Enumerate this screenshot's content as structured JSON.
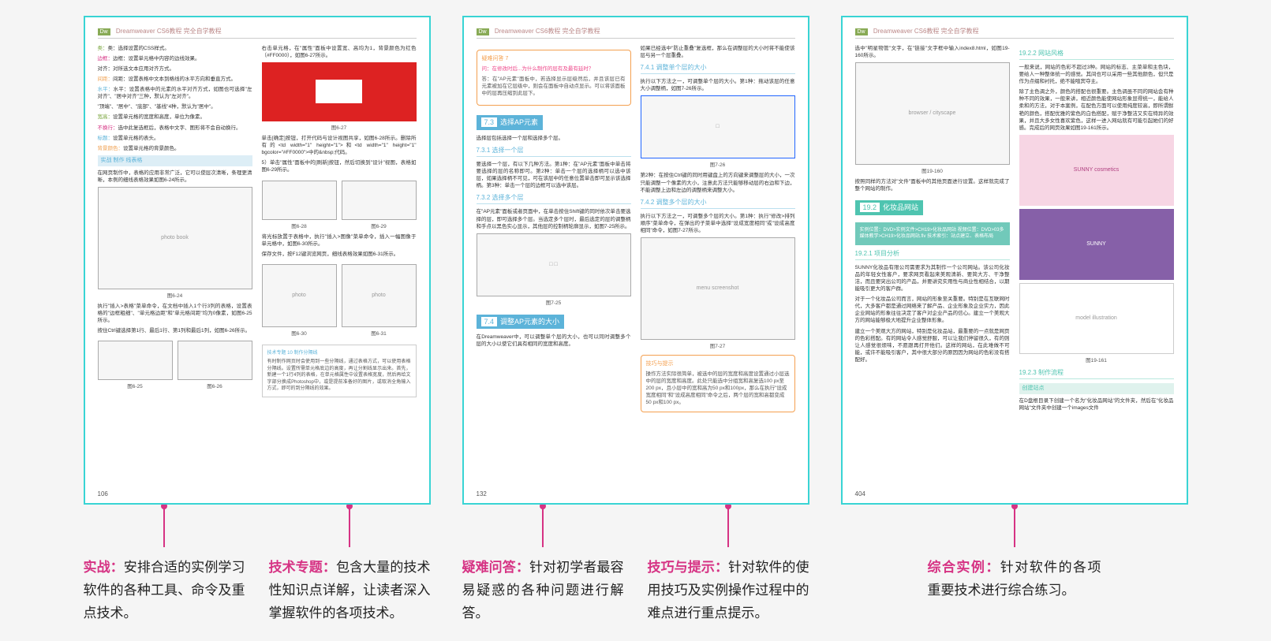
{
  "pages": {
    "p1": {
      "header_brand": "Dreamweaver CS6教程",
      "header_suffix": "完全自学教程",
      "left": {
        "l1": "类：选择设置的CSS样式。",
        "l2": "边框：设置单元格中内容的边线效果。",
        "l3": "对齐：对所选文本应用对齐方式。",
        "l4": "间距：设置表格中文本到格线的水平方向和垂直方式。",
        "l5": "水平：设置表格中的元素的水平对齐方式，如图也可选择\"左对齐\"、\"居中对齐\"三种，默认为\"左对齐\"。",
        "l6": "\"顶端\"、\"居中\"、\"底部\"、\"基线\"4种，默认为\"居中\"。",
        "l7_k": "宽高：",
        "l7": "设置单元格的宽度和高度，单位为像素。",
        "l8_k": "不换行：",
        "l8": "选中此复选框后，表格中文字、图形将不会自动换行。",
        "l9_k": "标题：",
        "l9": "设置单元格的表头。",
        "l10_k": "背景颜色：",
        "l10": "设置单元格的背景颜色。",
        "practice": "实战  制作    线表格",
        "p11": "在网页制作中，表格的应用非常广泛，它可以使层次清晰，条理更清晰，本例的细线表格效果如图6-24所示。",
        "p12": "执行\"插入>表格\"菜单命令，在文档中插入1个行3列的表格，设置表格的\"边框粗细\"、\"单元格边距\"和\"单元格间距\"均为0像素，如图6-25所示。",
        "p13": "按住Ctrl键选择第1行、最后1行、第1列和最后1列，如图6-26所示。",
        "fig624": "图6-24",
        "fig625": "图6-25",
        "fig626": "图6-26"
      },
      "right": {
        "r1": "右击单元格，在\"属性\"面板中设置宽、高均为1，背景颜色为红色（#FF0000），如图6-27所示。",
        "r2": "单击[确定]按钮，打开代码与设计视图共享，如图6-28所示。删除所有的<td width=\"1\" height=\"1\">和<td width=\"1\" height=\"1\" bgcolor=\"#FF0000\">中的&nbsp;代码。",
        "r3": "5）单击\"属性\"面板中的[刷新]按钮，然后切换到\"设计\"视图，表格如图6-29所示。",
        "r4": "将光标放置于表格中，执行\"插入>图像\"菜单命令，插入一幅图像于单元格中，如图6-30所示。",
        "r5": "保存文件，按F12键浏览网页，细线表格效果如图6-31所示。",
        "tech_title": "技术专题 10 制作分隔线",
        "tech_body": "有时制作网页时会使用到一些分隔线，通过表格方式，可以使用表格分隔线。设置所需单元格底边的高度，再让分割线显示出来。首先，新建一个1行4列的表格，在单元格属性中设置表格宽度，然后再给文字部分换成Photoshop中，或是提前准备好的图片，或取消全角输入方式，即可的到分隔线的效果。",
        "fig627": "图6-27",
        "fig628": "图6-28",
        "fig629": "图6-29",
        "fig630": "图6-30",
        "fig631": "图6-31"
      },
      "num": "106"
    },
    "p2": {
      "header_brand": "Dreamweaver CS6教程",
      "header_suffix": "完全自学教程",
      "qa_title": "疑难问答  7",
      "qa_q": "问：在修改时后...为什么制作的层有及最有延时？",
      "qa_a": "答：在\"AP元素\"面板中，若选择显示层级然后，并且该层已有元素被加在它层级中，则会在面板中自动点显示。可以将该面板中的层再压缩到此层下。",
      "s73": "选择AP元素",
      "s73_intro": "选择层包括选择一个层和选择多个层。",
      "s731": "7.3.1  选择一个层",
      "s731_t": "要选择一个层，有以下几种方法。第1种：在\"AP元素\"面板中单击将要选择的层的名称即可。第2种：单击一个层的选择柄可以选中该层，如果选择柄不可见，可在该层中的任意位置单击即可显示该选择柄。第3种：单击一个层的边框可以选中该层。",
      "s732": "7.3.2  选择多个层",
      "s732_t": "在\"AP元素\"面板或者页面中，在单击按住Shift键的同时依次单击要选择的层，即可选择多个层。当选定多个层时，最后选定的层的调整柄和手点以黑色实心显示，其他层的控制柄轮廓显示，如图7-25所示。",
      "s74": "调整AP元素的大小",
      "s74_t": "在Dreamweaver中，可以调整单个层的大小，也可以同时调整多个层的大小以使它们具有相同的宽度和高度。",
      "right": {
        "r1": "如果已经选中\"防止重叠\"复选框，那么在调整层的大小时将不能使该层与另一个层重叠。",
        "s741": "7.4.1  调整单个层的大小",
        "r2": "执行以下方法之一，可调整单个层的大小。第1种：拖动该层的任意大小调整柄，如图7-26所示。",
        "fig726": "图7-26",
        "r3": "第2种：在按住Ctrl键的同时用键盘上的方向键来调整层的大小，一次只能调整一个像素的大小，注意此方法只能够移动层的右边和下边，不能调整上边和左边的调整柄来调整大小。",
        "s742": "7.4.2  调整多个层的大小",
        "r4": "执行以下方法之一，可调整多个层的大小。第1种：执行\"修改>排列顺序\"菜单命令，在弹出的子菜单中选择\"设成宽度相同\"或\"设成高度相同\"命令，如图7-27所示。",
        "fig727": "图7-27",
        "tip_title": "技巧与提示",
        "tip_body": "操作方法实际很简单，被选中的层的宽度和高度设置通过小层选中的层的宽度和高度。此处只能选中分组宽和高复选100 px至200 px，且小层中的宽和高为50 px和100px，那么在执行\"设成宽度相同\"和\"设成高度相同\"命令之后，两个层的宽和高都变成50 px和100 px。",
        "fig725": "图7-25"
      },
      "num": "132"
    },
    "p3": {
      "header_brand": "Dreamweaver CS6教程",
      "header_suffix": "完全自学教程",
      "left": {
        "l1": "选中\"明星物管\"文字，在\"链接\"文字框中输入index8.html，如图19-160所示。",
        "fig160": "图19-160",
        "l2": "按照同样的方法对\"文件\"面板中的其他页面进行设置。这样就完成了整个网站的制作。",
        "s192": "化妆品网站",
        "info": "实例位置：DVD>实例文件>CH19>化妆品网站\n视频位置：DVD>03多媒体教学>CH19>化妆品网站.flv\n技术索引：站点建立、表格布局",
        "s1921": "19.2.1  项目分析",
        "p1": "SUNNY化妆品有限公司需要求为其制作一个公司网站。该公司化妆品的年轻女性客户，要求网页看起来美观清新、要简大方、干净整洁，而且要突出公司的产品，并要讲究实用性与商业性相结合，以期能吸引更大的客户群。",
        "p2": "对于一个化妆品公司而言，网站的形象至关重要。特别是在互联网时代，大多客户都是通过网络来了解产品、企业形象及企业实力，因此企业网站的形象往往决定了客户对企业产品的信心。建立一个美观大方的网站能够极大地提升企业整体形象。",
        "p3": "建立一个美观大方的网站，特别是化妆品站，最重要的一点就是网页的色彩搭配。有的网站令人感觉舒服，可以让我们停留很久，有的则让人感觉很烦味，不愿跟再打开他们。这样的网站，在此难做不可能，或许不能吸引客户，其中很大部分的原因因为网站的色彩没有搭配好。"
      },
      "right": {
        "s1922": "19.2.2  网站风格",
        "r1": "一般来说，网站的色彩不超过3种。网站的标志、主菜单和主色块，要给人一种整体统一的感觉。其间也可以采用一些其他颜色，但只是作为点缀和衬托，绝不能喧宾夺主。",
        "r2": "除了主色调之外，颜色的搭配也很重要。主色调虽不同的网站会有种种不同的效果，一般来讲，相近颜色能使网站形象显得统一，能给人柔和的方法，对于本案例，在配色方面可以使用纯度较高，即所谓鲜艳的颜色，搭配优雅的紫色的白色搭配，赋于净整洁又实在特异的效果，并且大多女性喜欢紫色，这样一进入网站就有可能引起她们的好感。完成后的网页效果如图19-161所示。",
        "fig161": "图19-161",
        "s1923": "19.2.3  制作流程",
        "step_title": "创建站点",
        "step": "在D盘根目录下创建一个名为\"化妆品网站\"的文件夹，然后在\"化妆品网站\"文件夹中创建一个images文件"
      },
      "num": "404"
    }
  },
  "captions": {
    "c1": {
      "lead": "实战：",
      "text": "安排合适的实例学习软件的各种工具、命令及重点技术。"
    },
    "c2": {
      "lead": "技术专题：",
      "text": "包含大量的技术性知识点详解，让读者深入掌握软件的各项技术。"
    },
    "c3": {
      "lead": "疑难问答：",
      "text": "针对初学者最容易疑惑的各种问题进行解答。"
    },
    "c4": {
      "lead": "技巧与提示：",
      "text": "针对软件的使用技巧及实例操作过程中的难点进行重点提示。"
    },
    "c5": {
      "lead": "综合实例：",
      "text": "针对软件的各项重要技术进行综合练习。"
    }
  }
}
